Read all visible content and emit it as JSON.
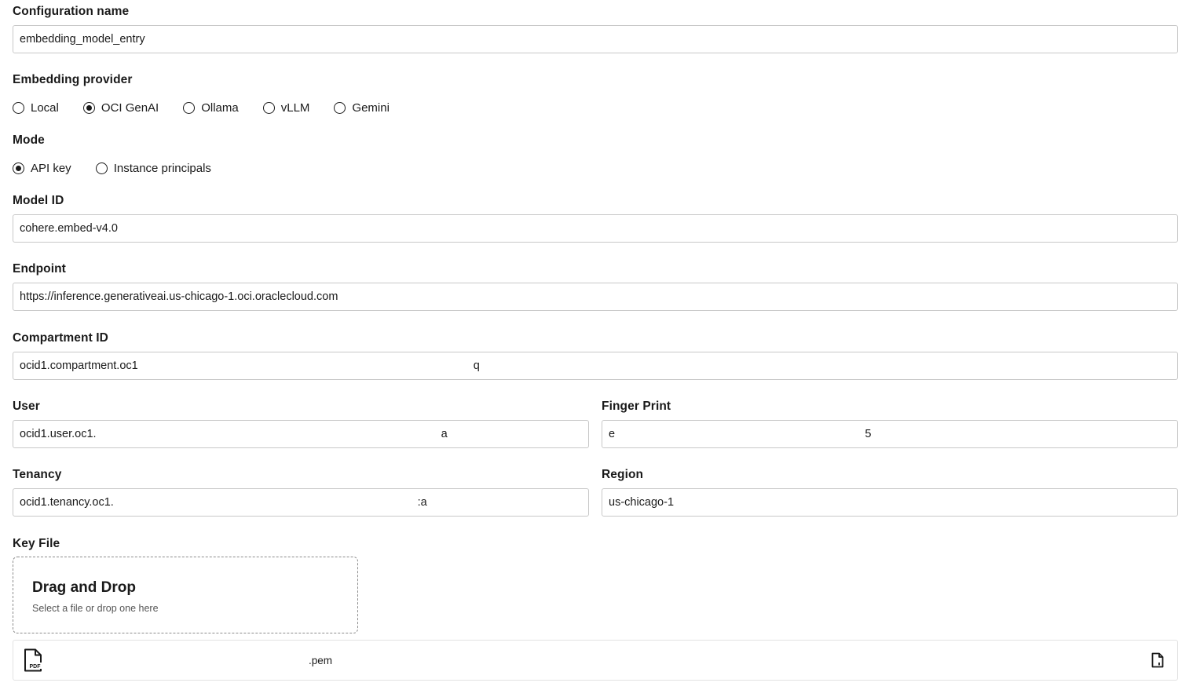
{
  "config_name": {
    "label": "Configuration name",
    "value": "embedding_model_entry"
  },
  "provider": {
    "label": "Embedding provider",
    "options": [
      {
        "label": "Local",
        "checked": false
      },
      {
        "label": "OCI GenAI",
        "checked": true
      },
      {
        "label": "Ollama",
        "checked": false
      },
      {
        "label": "vLLM",
        "checked": false
      },
      {
        "label": "Gemini",
        "checked": false
      }
    ]
  },
  "mode": {
    "label": "Mode",
    "options": [
      {
        "label": "API key",
        "checked": true
      },
      {
        "label": "Instance principals",
        "checked": false
      }
    ]
  },
  "model_id": {
    "label": "Model ID",
    "value": "cohere.embed-v4.0"
  },
  "endpoint": {
    "label": "Endpoint",
    "value": "https://inference.generativeai.us-chicago-1.oci.oraclecloud.com"
  },
  "compartment_id": {
    "label": "Compartment ID",
    "value": "ocid1.compartment.oc1                                                                                                          q"
  },
  "user": {
    "label": "User",
    "value": "ocid1.user.oc1.                                                                                                             a"
  },
  "fingerprint": {
    "label": "Finger Print",
    "value": "e                                                                               5"
  },
  "tenancy": {
    "label": "Tenancy",
    "value": "ocid1.tenancy.oc1.                                                                                                :a"
  },
  "region": {
    "label": "Region",
    "value": "us-chicago-1"
  },
  "key_file": {
    "label": "Key File",
    "drop_title": "Drag and Drop",
    "drop_subtitle": "Select a file or drop one here",
    "file_name": ".pem",
    "file_icon": "pdf-file-icon",
    "action_icon": "document-icon"
  }
}
